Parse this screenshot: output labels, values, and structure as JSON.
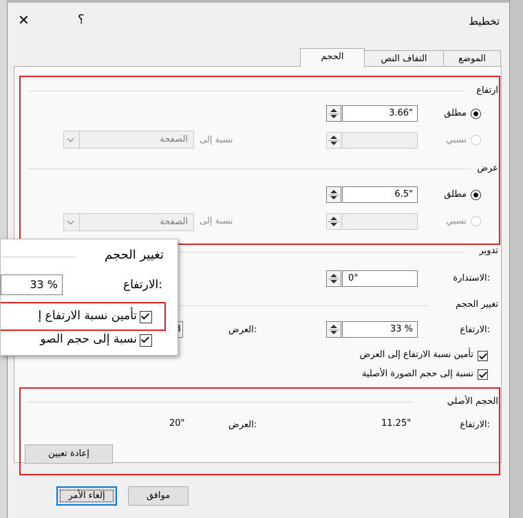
{
  "dialog": {
    "title": "تخطيط",
    "help_label": "؟",
    "close_label": "✕"
  },
  "tabs": [
    {
      "label": "الموضع",
      "active": false
    },
    {
      "label": "التفاف النص",
      "active": false
    },
    {
      "label": "الحجم",
      "active": true
    }
  ],
  "height_group": {
    "title": "ارتفاع",
    "absolute_label": "مطلق",
    "absolute_value": "3.66\"",
    "relative_label": "نسبي",
    "relative_to_label": "نسبة إلى",
    "relative_to_value": "الصفحة"
  },
  "width_group": {
    "title": "عرض",
    "absolute_label": "مطلق",
    "absolute_value": "6.5\"",
    "relative_label": "نسبي",
    "relative_to_label": "نسبة إلى",
    "relative_to_value": "الصفحة"
  },
  "rotate_group": {
    "title": "تدوير",
    "rotation_label": "الاستدارة:",
    "rotation_value": "0°"
  },
  "scale_group": {
    "title": "تغيير الحجم",
    "height_label": "الارتفاع:",
    "height_value": "33 %",
    "width_label": "العرض:",
    "width_value": "3",
    "lock_aspect_label": "تأمين نسبة الارتفاع إلى العرض",
    "relative_original_label": "نسبة إلى حجم الصورة الأصلية"
  },
  "original_group": {
    "title": "الحجم الأصلي",
    "height_label": "الارتفاع:",
    "height_value": "11.25\"",
    "width_label": "العرض:",
    "width_value": "20\"",
    "reset_label": "إعادة تعيين"
  },
  "buttons": {
    "ok_label": "موافق",
    "cancel_label": "إلغاء الأمر"
  },
  "zoom_callout": {
    "title": "تغيير الحجم",
    "height_label": "الارتفاع:",
    "height_value": "33 %",
    "lock_aspect_label": "تأمين نسبة الارتفاع إ",
    "relative_original_label": "نسبة إلى حجم الصو"
  },
  "colors": {
    "highlight_red": "#e02424",
    "default_button_blue": "#0078d7",
    "dialog_bg": "#f0f0f0"
  }
}
